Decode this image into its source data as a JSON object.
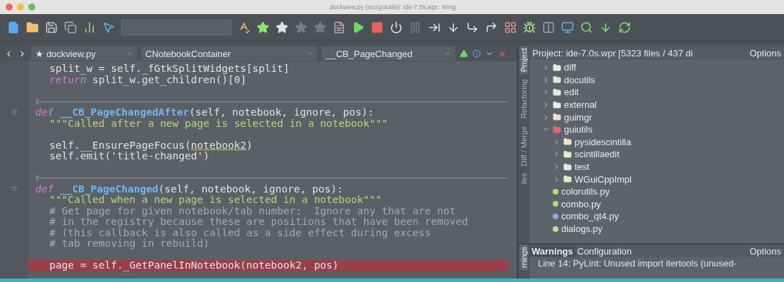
{
  "window": {
    "title": "dockview.py (src/guiutils): ide-7.0s.wpr: Wing"
  },
  "editor_nav": {
    "file": "dockview.py",
    "file_mark": "★",
    "class": "CNotebookContainer",
    "method": "__CB_PageChanged"
  },
  "editor": {
    "lines": [
      {
        "kind": "body",
        "tokens": [
          {
            "kind": "plain",
            "t": "split_w = self._fGtkSplitWidgets[split]"
          }
        ]
      },
      {
        "kind": "body",
        "tokens": [
          {
            "kind": "keyword",
            "t": "return"
          },
          {
            "kind": "plain",
            "t": " split_w.get_children()[0]"
          }
        ]
      },
      {
        "kind": "blank"
      },
      {
        "kind": "separator",
        "text": "#"
      },
      {
        "kind": "def",
        "tokens": [
          {
            "kind": "keyword",
            "t": "def "
          },
          {
            "kind": "function",
            "t": "__CB_PageChangedAfter"
          },
          {
            "kind": "plain",
            "t": "(self, notebook, ignore, pos):"
          }
        ]
      },
      {
        "kind": "body",
        "tokens": [
          {
            "kind": "string",
            "t": "\"\"\"Called after a new page is selected in a notebook\"\"\""
          }
        ]
      },
      {
        "kind": "blank"
      },
      {
        "kind": "body",
        "tokens": [
          {
            "kind": "plain",
            "t": "self.__EnsurePageFocus("
          },
          {
            "kind": "warning",
            "t": "notebook2"
          },
          {
            "kind": "plain",
            "t": ")"
          }
        ]
      },
      {
        "kind": "body",
        "tokens": [
          {
            "kind": "plain",
            "t": "self.emit('title-changed')"
          }
        ]
      },
      {
        "kind": "blank"
      },
      {
        "kind": "separator",
        "text": "#"
      },
      {
        "kind": "def",
        "tokens": [
          {
            "kind": "keyword",
            "t": "def "
          },
          {
            "kind": "function",
            "t": "__CB_PageChanged"
          },
          {
            "kind": "plain",
            "t": "(self, notebook, ignore, pos):"
          }
        ]
      },
      {
        "kind": "body",
        "tokens": [
          {
            "kind": "string",
            "t": "\"\"\"Called when a new page is selected in a notebook\"\"\""
          }
        ]
      },
      {
        "kind": "body",
        "tokens": [
          {
            "kind": "comment",
            "t": "# Get page for given notebook/tab number:  Ignore any that are not"
          }
        ]
      },
      {
        "kind": "body",
        "tokens": [
          {
            "kind": "comment",
            "t": "# in the registry because these are positions that have been removed"
          }
        ]
      },
      {
        "kind": "body",
        "tokens": [
          {
            "kind": "comment",
            "t": "# (this callback is also called as a side effect during excess"
          }
        ]
      },
      {
        "kind": "body",
        "tokens": [
          {
            "kind": "comment",
            "t": "# tab removing in rebuild)"
          }
        ]
      },
      {
        "kind": "blank"
      },
      {
        "kind": "body",
        "highlight": true,
        "tokens": [
          {
            "kind": "plain",
            "t": "page = self._GetPanelInNotebook(notebook2, pos)"
          }
        ]
      }
    ]
  },
  "side_tabs": [
    {
      "label": "Project",
      "selected": true
    },
    {
      "label": "Refactoring",
      "selected": false
    },
    {
      "label": "Diff / Merge",
      "selected": false
    },
    {
      "label": "iles",
      "selected": false
    }
  ],
  "project": {
    "header": "Project: ide-7.0s.wpr [5323 files / 437 di",
    "options": "Options",
    "tree": [
      {
        "label": "diff",
        "kind": "folder",
        "expanded": false,
        "color": "#e8e8e0"
      },
      {
        "label": "docutils",
        "kind": "folder",
        "expanded": false,
        "color": "#e8e8c8"
      },
      {
        "label": "edit",
        "kind": "folder",
        "expanded": false,
        "color": "#e8e8e0"
      },
      {
        "label": "external",
        "kind": "folder",
        "expanded": false,
        "color": "#e8e8e0"
      },
      {
        "label": "guimgr",
        "kind": "folder",
        "expanded": false,
        "color": "#e8e0c8"
      },
      {
        "label": "guiutils",
        "kind": "folder",
        "expanded": true,
        "color": "#e06a6a",
        "children": [
          {
            "label": "pysidescintilla",
            "kind": "folder",
            "expanded": false,
            "color": "#e8e8c8"
          },
          {
            "label": "scintillaedit",
            "kind": "folder",
            "expanded": false,
            "color": "#e8e8c8"
          },
          {
            "label": "test",
            "kind": "folder",
            "expanded": false,
            "color": "#e8e8e0"
          },
          {
            "label": "WGuiCppImpl",
            "kind": "folder",
            "expanded": false,
            "color": "#e8e8c8"
          },
          {
            "label": "colorutils.py",
            "kind": "file",
            "color": "#b8d878"
          },
          {
            "label": "combo.py",
            "kind": "file",
            "color": "#b8d878"
          },
          {
            "label": "combo_qt4.py",
            "kind": "file",
            "color": "#8aa8e8"
          },
          {
            "label": "dialogs.py",
            "kind": "file",
            "color": "#c8d8a8"
          }
        ]
      }
    ]
  },
  "bottom_side_tab": {
    "label": "rnings",
    "selected": true
  },
  "warnings": {
    "tabs": [
      {
        "label": "Warnings",
        "selected": true
      },
      {
        "label": "Configuration",
        "selected": false
      }
    ],
    "options": "Options",
    "rows": [
      "Line 14: PyLint: Unused import itertools (unused-"
    ]
  }
}
